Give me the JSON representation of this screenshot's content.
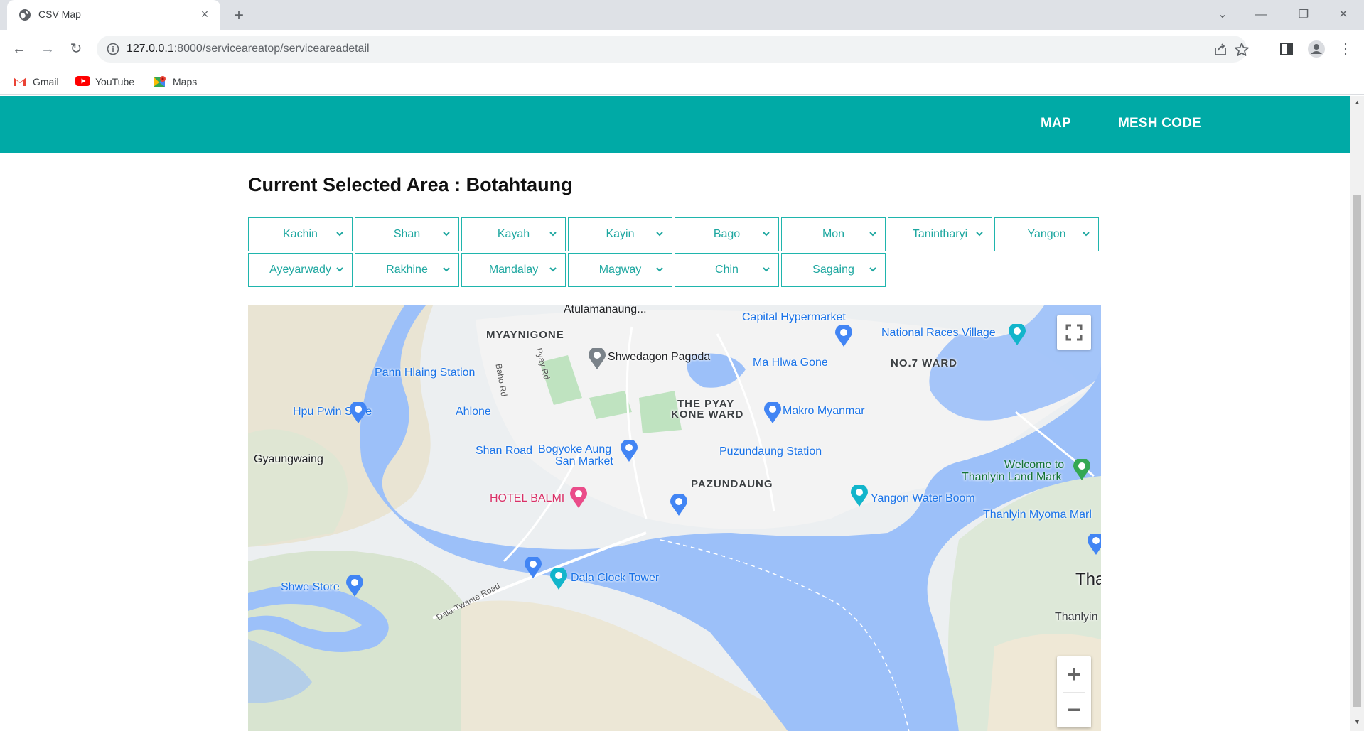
{
  "browser": {
    "tab_title": "CSV Map",
    "url_host": "127.0.0.1",
    "url_rest": ":8000/serviceareatop/serviceareadetail",
    "bookmarks": [
      "Gmail",
      "YouTube",
      "Maps"
    ]
  },
  "navbar": {
    "links": [
      "MAP",
      "MESH CODE"
    ],
    "color": "#00aaa6"
  },
  "page": {
    "title": "Current Selected Area : Botahtaung"
  },
  "regions": {
    "row1": [
      "Kachin",
      "Shan",
      "Kayah",
      "Kayin",
      "Bago",
      "Mon",
      "Tanintharyi",
      "Yangon"
    ],
    "row2": [
      "Ayeyarwady",
      "Rakhine",
      "Mandalay",
      "Magway",
      "Chin",
      "Sagaing"
    ],
    "accent": "#1fb5ad"
  },
  "map": {
    "labels": {
      "atulamanaung": "Atulamanaung...",
      "capital": "Capital Hypermarket",
      "national": "National Races Village",
      "myaynigone": "MYAYNIGONE",
      "shwedagon": "Shwedagon Pagoda",
      "mahlwagone": "Ma Hlwa Gone",
      "no7ward": "NO.7 WARD",
      "pannhlaing": "Pann Hlaing Station",
      "hpupwin": "Hpu Pwin Store",
      "ahlone": "Ahlone",
      "pyaykone1": "THE PYAY",
      "pyaykone2": "KONE WARD",
      "makro": "Makro Myanmar",
      "gyaungwaing": "Gyaungwaing",
      "shanroad": "Shan Road",
      "bogyoke1": "Bogyoke Aung",
      "bogyoke2": "San Market",
      "puzundaungstation": "Puzundaung Station",
      "welcome1": "Welcome to",
      "welcome2": "Thanlyin Land Mark",
      "pazundaung": "PAZUNDAUNG",
      "hotel": "HOTEL BALMI",
      "yangonwaterboom": "Yangon Water Boom",
      "thanlyinmyoma": "Thanlyin Myoma Marl",
      "dala": "Dala Clock Tower",
      "shwestore": "Shwe Store",
      "dalatwante": "Dala-Twante Road",
      "bahord": "Baho Rd",
      "pyayrd": "Pyay Rd",
      "tha": "Tha",
      "thanlyin": "Thanlyin"
    },
    "controls": {
      "zoom_in": "+",
      "zoom_out": "−"
    }
  }
}
